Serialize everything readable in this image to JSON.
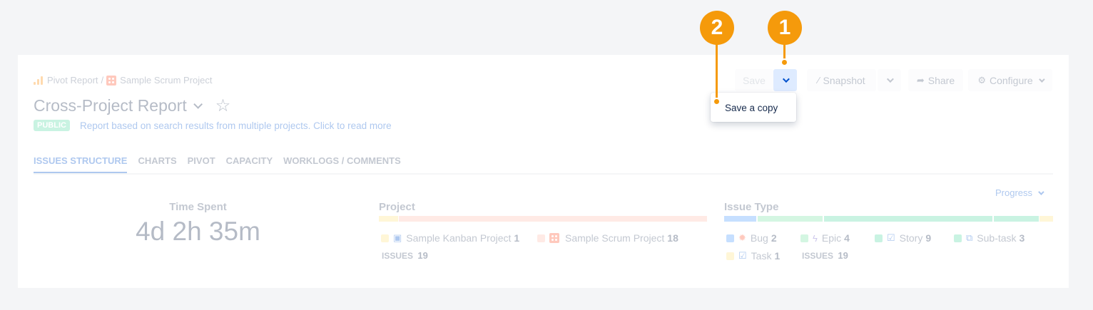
{
  "breadcrumb": {
    "pivot": "Pivot Report",
    "separator": "/",
    "project": "Sample Scrum Project"
  },
  "title": "Cross-Project Report",
  "badge": "PUBLIC",
  "description": "Report based on search results from multiple projects. Click to read more",
  "tabs": [
    {
      "label": "ISSUES STRUCTURE",
      "active": true
    },
    {
      "label": "CHARTS"
    },
    {
      "label": "PIVOT"
    },
    {
      "label": "CAPACITY"
    },
    {
      "label": "WORKLOGS / COMMENTS"
    }
  ],
  "toolbar": {
    "save": "Save",
    "snapshot": "Snapshot",
    "share": "Share",
    "configure": "Configure"
  },
  "dropdown": {
    "save_copy": "Save a copy"
  },
  "progress": "Progress",
  "time_spent": {
    "label": "Time Spent",
    "value": "4d 2h 35m"
  },
  "project_section": {
    "label": "Project",
    "items": [
      {
        "name": "Sample Kanban Project",
        "count": "1",
        "color": "#ffe380"
      },
      {
        "name": "Sample Scrum Project",
        "count": "18",
        "color": "#ffbdad"
      }
    ],
    "issues_label": "ISSUES",
    "issues_total": "19"
  },
  "issue_type_section": {
    "label": "Issue Type",
    "items": [
      {
        "name": "Bug",
        "count": "2",
        "color": "#4c9aff",
        "icon": "bug-icon"
      },
      {
        "name": "Epic",
        "count": "4",
        "color": "#79e2a3",
        "icon": "lightning-icon"
      },
      {
        "name": "Story",
        "count": "9",
        "color": "#57d9a3",
        "icon": "check-icon"
      },
      {
        "name": "Sub-task",
        "count": "3",
        "color": "#57d9a3",
        "icon": "subtask-icon"
      },
      {
        "name": "Task",
        "count": "1",
        "color": "#ffe380",
        "icon": "check-icon"
      }
    ],
    "issues_label": "ISSUES",
    "issues_total": "19"
  },
  "markers": {
    "one": "1",
    "two": "2"
  }
}
